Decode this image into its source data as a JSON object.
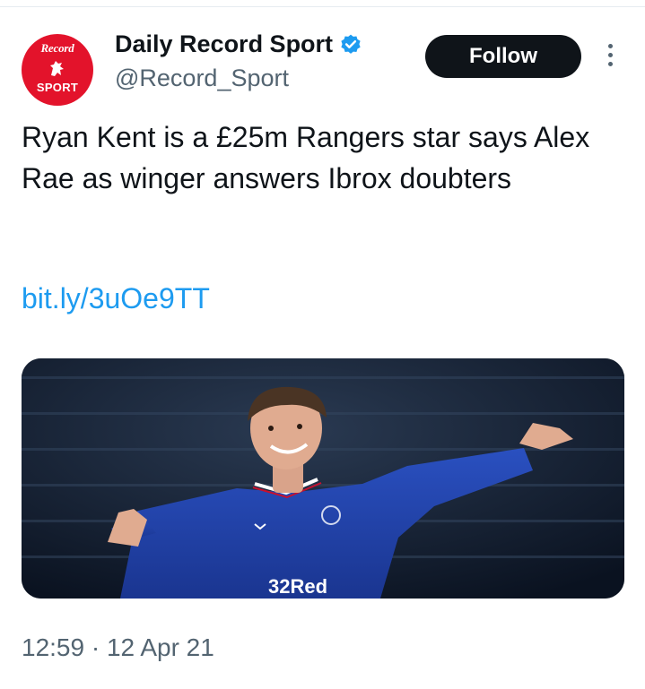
{
  "account": {
    "avatar_line1": "Record",
    "avatar_line2": "SPORT",
    "display_name": "Daily Record Sport",
    "handle": "@Record_Sport",
    "verified": true
  },
  "actions": {
    "follow_label": "Follow",
    "more_icon": "more-vertical-icon"
  },
  "tweet": {
    "text": "Ryan Kent is a £25m Rangers star says Alex Rae as winger answers Ibrox doubters",
    "link": "bit.ly/3uOe9TT",
    "timestamp": "12:59 · 12 Apr 21"
  },
  "media": {
    "shirt_sponsor": "32Red"
  },
  "colors": {
    "brand_red": "#e3132b",
    "link_blue": "#1d9bf0",
    "text_primary": "#0f1419",
    "text_secondary": "#536471",
    "kit_blue": "#1f3d9e"
  }
}
